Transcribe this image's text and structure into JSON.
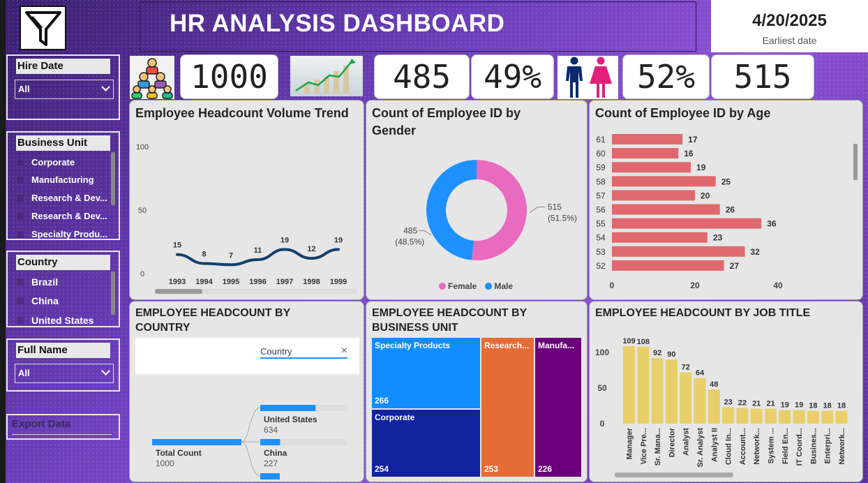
{
  "header": {
    "title": "HR ANALYSIS DASHBOARD",
    "date_value": "4/20/2025",
    "date_caption": "Earliest date"
  },
  "slicers": {
    "hire_date": {
      "label": "Hire Date",
      "value": "All"
    },
    "business_unit": {
      "label": "Business Unit",
      "items": [
        "Corporate",
        "Manufacturing",
        "Research & Dev...",
        "Research & Dev...",
        "Specialty Produ..."
      ]
    },
    "country": {
      "label": "Country",
      "items": [
        "Brazil",
        "China",
        "United States"
      ]
    },
    "full_name": {
      "label": "Full Name",
      "value": "All"
    },
    "export": {
      "label": "Export Data"
    }
  },
  "kpis": {
    "total": "1000",
    "male_count": "485",
    "male_pct": "49%",
    "female_pct": "52%",
    "female_count": "515"
  },
  "headcount_trend": {
    "title": "Employee Headcount Volume Trend",
    "chart_data": {
      "type": "line",
      "x": [
        "1993",
        "1994",
        "1995",
        "1996",
        "1997",
        "1998",
        "1999"
      ],
      "values": [
        15,
        8,
        7,
        11,
        19,
        12,
        19
      ],
      "y_ticks": [
        "100",
        "50",
        "0"
      ],
      "ylim": [
        0,
        100
      ],
      "color": "#12406e"
    }
  },
  "gender": {
    "title": "Count of Employee ID by Gender",
    "chart_data": {
      "type": "pie",
      "categories": [
        "Female",
        "Male"
      ],
      "values": [
        515,
        485
      ],
      "labels": [
        {
          "value": "515",
          "pct": "(51.5%)"
        },
        {
          "value": "485",
          "pct": "(48.5%)"
        }
      ],
      "colors": [
        "#e86bbf",
        "#1e90ff"
      ],
      "donut": true,
      "legend": "bottom"
    }
  },
  "age": {
    "title": "Count of Employee ID by Age",
    "chart_data": {
      "type": "bar",
      "orientation": "horizontal",
      "categories": [
        "61",
        "60",
        "59",
        "58",
        "57",
        "56",
        "55",
        "54",
        "53",
        "52"
      ],
      "values": [
        17,
        16,
        19,
        25,
        20,
        26,
        36,
        23,
        32,
        27
      ],
      "x_ticks": [
        "0",
        "20",
        "40"
      ],
      "xlim": [
        0,
        40
      ],
      "color": "#e0696f"
    }
  },
  "country_tree": {
    "title": "EMPLOYEE HEADCOUNT BY COUNTRY",
    "filter_label": "Country",
    "close_glyph": "×",
    "root_label": "Total Count",
    "root_value": "1000",
    "chart_data": {
      "type": "bar",
      "categories": [
        "United States",
        "China"
      ],
      "values": [
        634,
        227
      ],
      "total": 1000,
      "color": "#1e90ff"
    }
  },
  "business_unit": {
    "title": "EMPLOYEE HEADCOUNT BY BUSINESS UNIT",
    "chart_data": {
      "type": "heatmap",
      "categories": [
        "Specialty Products",
        "Corporate",
        "Research...",
        "Manufa..."
      ],
      "values": [
        266,
        254,
        253,
        226
      ],
      "colors": [
        "#118dff",
        "#12239e",
        "#e66c37",
        "#6b007b"
      ]
    }
  },
  "job_title": {
    "title": "EMPLOYEE HEADCOUNT BY JOB TITLE",
    "chart_data": {
      "type": "bar",
      "categories": [
        "Manager",
        "Vice Pre...",
        "Sr. Mana...",
        "Director",
        "Analyst",
        "Sr. Analyst",
        "Analyst II",
        "Cloud In...",
        "Account...",
        "Network...",
        "System ...",
        "Field En...",
        "IT Coord...",
        "Busines...",
        "Enterpri...",
        "Network..."
      ],
      "values": [
        109,
        108,
        92,
        90,
        72,
        64,
        48,
        23,
        22,
        21,
        21,
        19,
        19,
        18,
        18,
        18
      ],
      "y_ticks": [
        "100",
        "50",
        "0"
      ],
      "ylim": [
        0,
        110
      ],
      "color": "#e8cf6a"
    }
  }
}
